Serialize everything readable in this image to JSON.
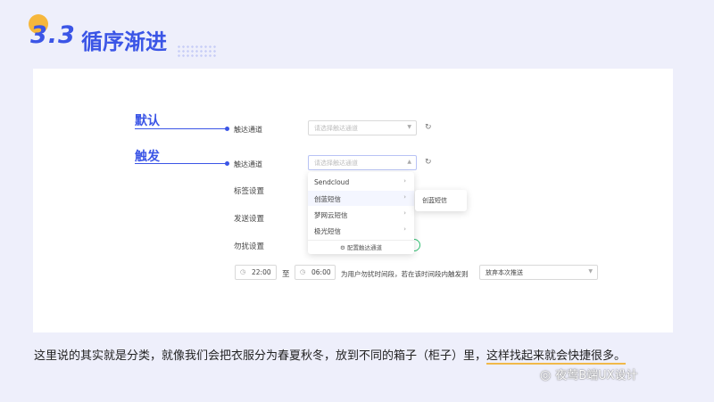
{
  "header": {
    "number": "3.3",
    "title": "循序渐进"
  },
  "annotations": {
    "default": "默认",
    "triggered": "触发"
  },
  "form": {
    "channel_label_1": "触达通道",
    "channel_placeholder_1": "请选择触达通道",
    "channel_label_2": "触达通道",
    "channel_placeholder_2": "请选择触达通道",
    "tag_setting": "标签设置",
    "send_setting": "发送设置",
    "dnd_setting": "勿扰设置",
    "time_from": "22:00",
    "to_label": "至",
    "time_to": "06:00",
    "dnd_hint": "为用户勿扰时间段，若在该时间段内触发则",
    "dnd_action": "放弃本次推送"
  },
  "dropdown": {
    "items": [
      {
        "label": "Sendcloud"
      },
      {
        "label": "创蓝短信"
      },
      {
        "label": "梦网云短信"
      },
      {
        "label": "极光短信"
      }
    ],
    "footer": "配置触达通道",
    "submenu_item": "创蓝短信"
  },
  "caption": {
    "part1": "这里说的其实就是分类，就像我们会把衣服分为春夏秋冬，放到不同的箱子（柜子）里，",
    "part2": "这样找起来就会快捷很多。"
  },
  "watermark": "夜莺B端UX设计",
  "colors": {
    "accent": "#3b55e6",
    "background": "#eeeffb",
    "highlight_underline": "#f1b94a",
    "toggle": "#2fbf71"
  }
}
